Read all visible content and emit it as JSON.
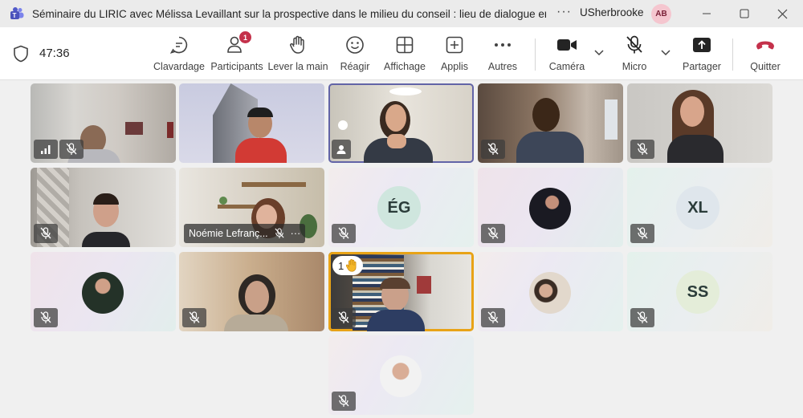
{
  "window": {
    "title": "Séminaire du LIRIC avec Mélissa Levaillant sur la prospective dans le milieu du conseil : lieu de dialogue entr...",
    "more": "···",
    "org": "USherbrooke",
    "user_initials": "AB"
  },
  "meeting": {
    "timer": "47:36"
  },
  "toolbar": {
    "chat": "Clavardage",
    "participants": "Participants",
    "participants_badge": "1",
    "raise_hand": "Lever la main",
    "react": "Réagir",
    "view": "Affichage",
    "apps": "Applis",
    "more": "Autres",
    "camera": "Caméra",
    "mic": "Micro",
    "share": "Partager",
    "leave": "Quitter"
  },
  "tiles": {
    "eg": "ÉG",
    "xl": "XL",
    "ss": "SS",
    "noemie_name": "Noémie Lefranç...",
    "noemie_more": "···",
    "hand_count": "1"
  },
  "colors": {
    "accent": "#6264a7",
    "leave": "#c4314b",
    "hand_outline": "#e8a317",
    "badge": "#c4314b"
  }
}
